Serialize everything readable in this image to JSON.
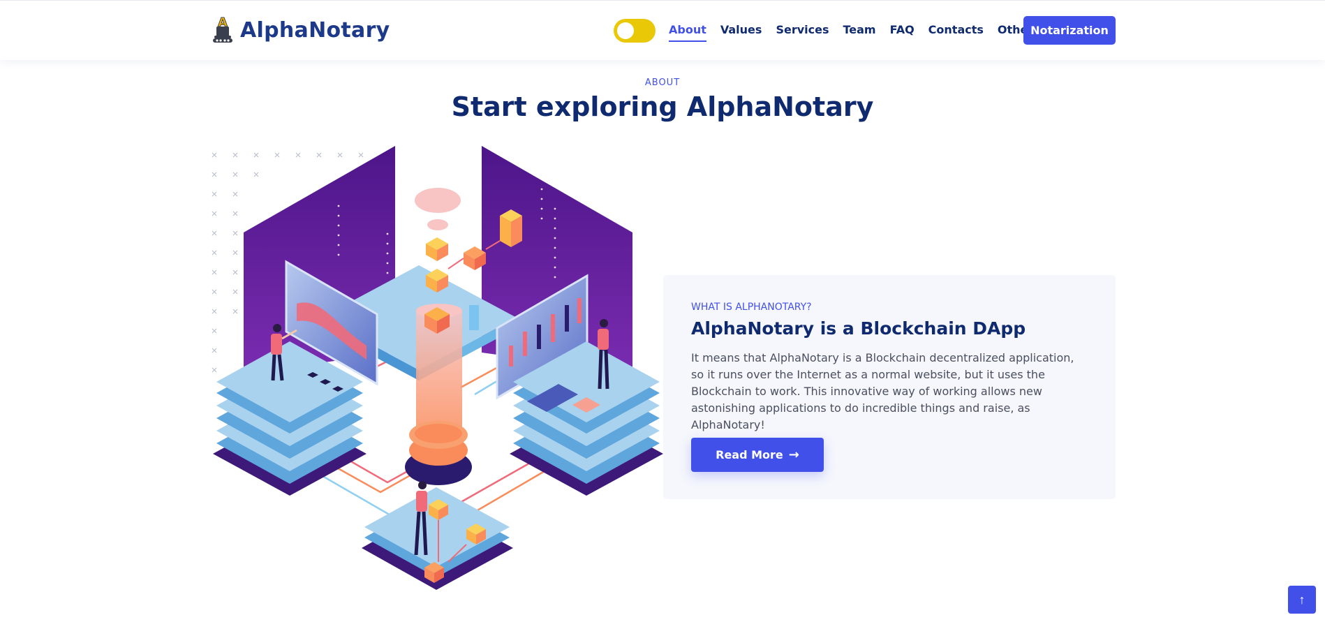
{
  "header": {
    "brand": "AlphaNotary",
    "logo_letter": "A",
    "nav": [
      "About",
      "Values",
      "Services",
      "Team",
      "FAQ",
      "Contacts",
      "Others"
    ],
    "active_nav": "About",
    "cta_label": "Notarization",
    "theme_toggle": "theme-toggle"
  },
  "section": {
    "eyebrow": "ABOUT",
    "title": "Start exploring AlphaNotary"
  },
  "card": {
    "eyebrow": "WHAT IS ALPHANOTARY?",
    "title": "AlphaNotary is a Blockchain DApp",
    "body": "It means that AlphaNotary is a Blockchain decentralized application, so it runs over the Internet as a normal website, but it uses the Blockchain to work. This innovative way of working allows new astonishing applications to do incredible things and raise, as AlphaNotary!",
    "button_label": "Read More",
    "button_arrow": "→"
  },
  "scroll_top": {
    "icon": "↑",
    "icon_name": "arrow-up-icon"
  },
  "colors": {
    "primary": "#4250ea",
    "navy": "#0f2a6e",
    "toggle": "#e8c807",
    "card_bg": "#f5f7fd",
    "panel_purple": "#5a1d96",
    "server_blue": "#a8d2ee",
    "orange": "#f98c5a"
  },
  "icons": {
    "logo": "notary-logo-icon",
    "dropdown": "chevron-down-icon",
    "illustration": "blockchain-illustration"
  }
}
